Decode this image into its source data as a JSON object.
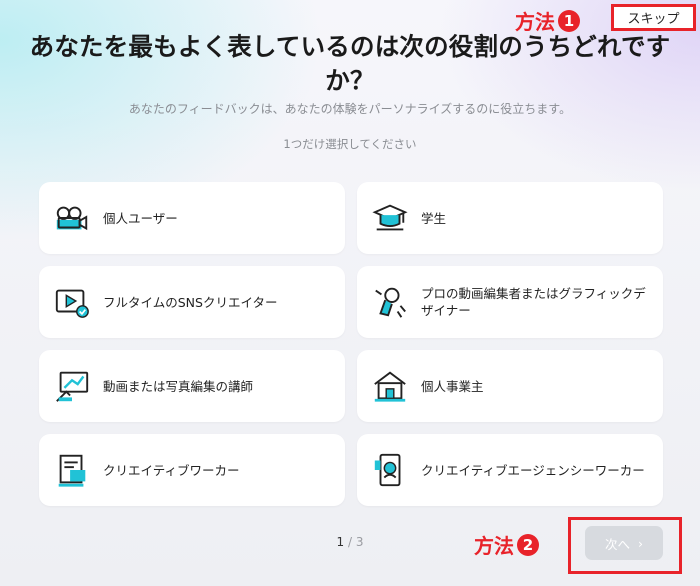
{
  "annotations": {
    "method1_text": "方法",
    "method1_num": "1",
    "method2_text": "方法",
    "method2_num": "2"
  },
  "header": {
    "skip_label": "スキップ",
    "title": "あなたを最もよく表しているのは次の役割のうちどれですか？",
    "subtitle": "あなたのフィードバックは、あなたの体験をパーソナライズするのに役立ちます。",
    "hint": "1つだけ選択してください"
  },
  "options": [
    {
      "label": "個人ユーザー",
      "icon": "camera-icon"
    },
    {
      "label": "学生",
      "icon": "graduation-cap-icon"
    },
    {
      "label": "フルタイムのSNSクリエイター",
      "icon": "video-player-icon"
    },
    {
      "label": "プロの動画編集者またはグラフィックデザイナー",
      "icon": "pen-tool-icon"
    },
    {
      "label": "動画または写真編集の講師",
      "icon": "whiteboard-icon"
    },
    {
      "label": "個人事業主",
      "icon": "house-icon"
    },
    {
      "label": "クリエイティブワーカー",
      "icon": "document-icon"
    },
    {
      "label": "クリエイティブエージェンシーワーカー",
      "icon": "phone-photo-icon"
    }
  ],
  "pagination": {
    "current": "1",
    "separator": " / ",
    "total": "3"
  },
  "footer": {
    "next_label": "次へ",
    "next_arrow": "›"
  },
  "colors": {
    "accent_teal": "#21c2d6",
    "annotation_red": "#e8232a",
    "button_disabled": "#d7dadf"
  }
}
